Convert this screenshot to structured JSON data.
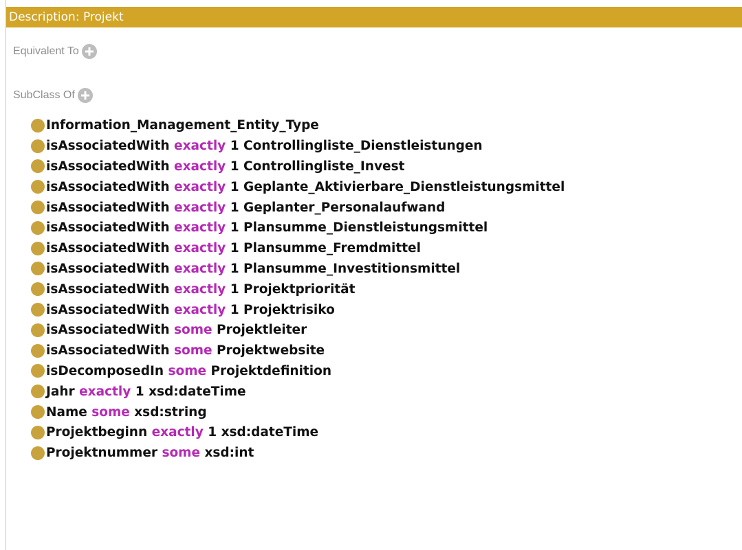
{
  "header": {
    "title": "Description: Projekt"
  },
  "sections": {
    "equivalent": {
      "label": "Equivalent To"
    },
    "subclass": {
      "label": "SubClass Of"
    }
  },
  "colors": {
    "header_bg": "#d2a528",
    "keyword": "#b52ab5",
    "class_dot": "#c8a23c",
    "add_button": "#bdbdbd"
  },
  "icons": {
    "add": "add-icon",
    "class": "class-dot-icon"
  },
  "axioms": [
    {
      "prop": "Information_Management_Entity_Type",
      "kw": "",
      "num": "",
      "filler": ""
    },
    {
      "prop": "isAssociatedWith",
      "kw": "exactly",
      "num": "1",
      "filler": "Controllingliste_Dienstleistungen"
    },
    {
      "prop": "isAssociatedWith",
      "kw": "exactly",
      "num": "1",
      "filler": "Controllingliste_Invest"
    },
    {
      "prop": "isAssociatedWith",
      "kw": "exactly",
      "num": "1",
      "filler": "Geplante_Aktivierbare_Dienstleistungsmittel"
    },
    {
      "prop": "isAssociatedWith",
      "kw": "exactly",
      "num": "1",
      "filler": "Geplanter_Personalaufwand"
    },
    {
      "prop": "isAssociatedWith",
      "kw": "exactly",
      "num": "1",
      "filler": "Plansumme_Dienstleistungsmittel"
    },
    {
      "prop": "isAssociatedWith",
      "kw": "exactly",
      "num": "1",
      "filler": "Plansumme_Fremdmittel"
    },
    {
      "prop": "isAssociatedWith",
      "kw": "exactly",
      "num": "1",
      "filler": "Plansumme_Investitionsmittel"
    },
    {
      "prop": "isAssociatedWith",
      "kw": "exactly",
      "num": "1",
      "filler": "Projektpriorität"
    },
    {
      "prop": "isAssociatedWith",
      "kw": "exactly",
      "num": "1",
      "filler": "Projektrisiko"
    },
    {
      "prop": "isAssociatedWith",
      "kw": "some",
      "num": "",
      "filler": "Projektleiter"
    },
    {
      "prop": "isAssociatedWith",
      "kw": "some",
      "num": "",
      "filler": "Projektwebsite"
    },
    {
      "prop": "isDecomposedIn",
      "kw": "some",
      "num": "",
      "filler": "Projektdefinition"
    },
    {
      "prop": "Jahr",
      "kw": "exactly",
      "num": "1",
      "filler": "xsd:dateTime"
    },
    {
      "prop": "Name",
      "kw": "some",
      "num": "",
      "filler": "xsd:string"
    },
    {
      "prop": "Projektbeginn",
      "kw": "exactly",
      "num": "1",
      "filler": "xsd:dateTime"
    },
    {
      "prop": "Projektnummer",
      "kw": "some",
      "num": "",
      "filler": "xsd:int"
    }
  ]
}
